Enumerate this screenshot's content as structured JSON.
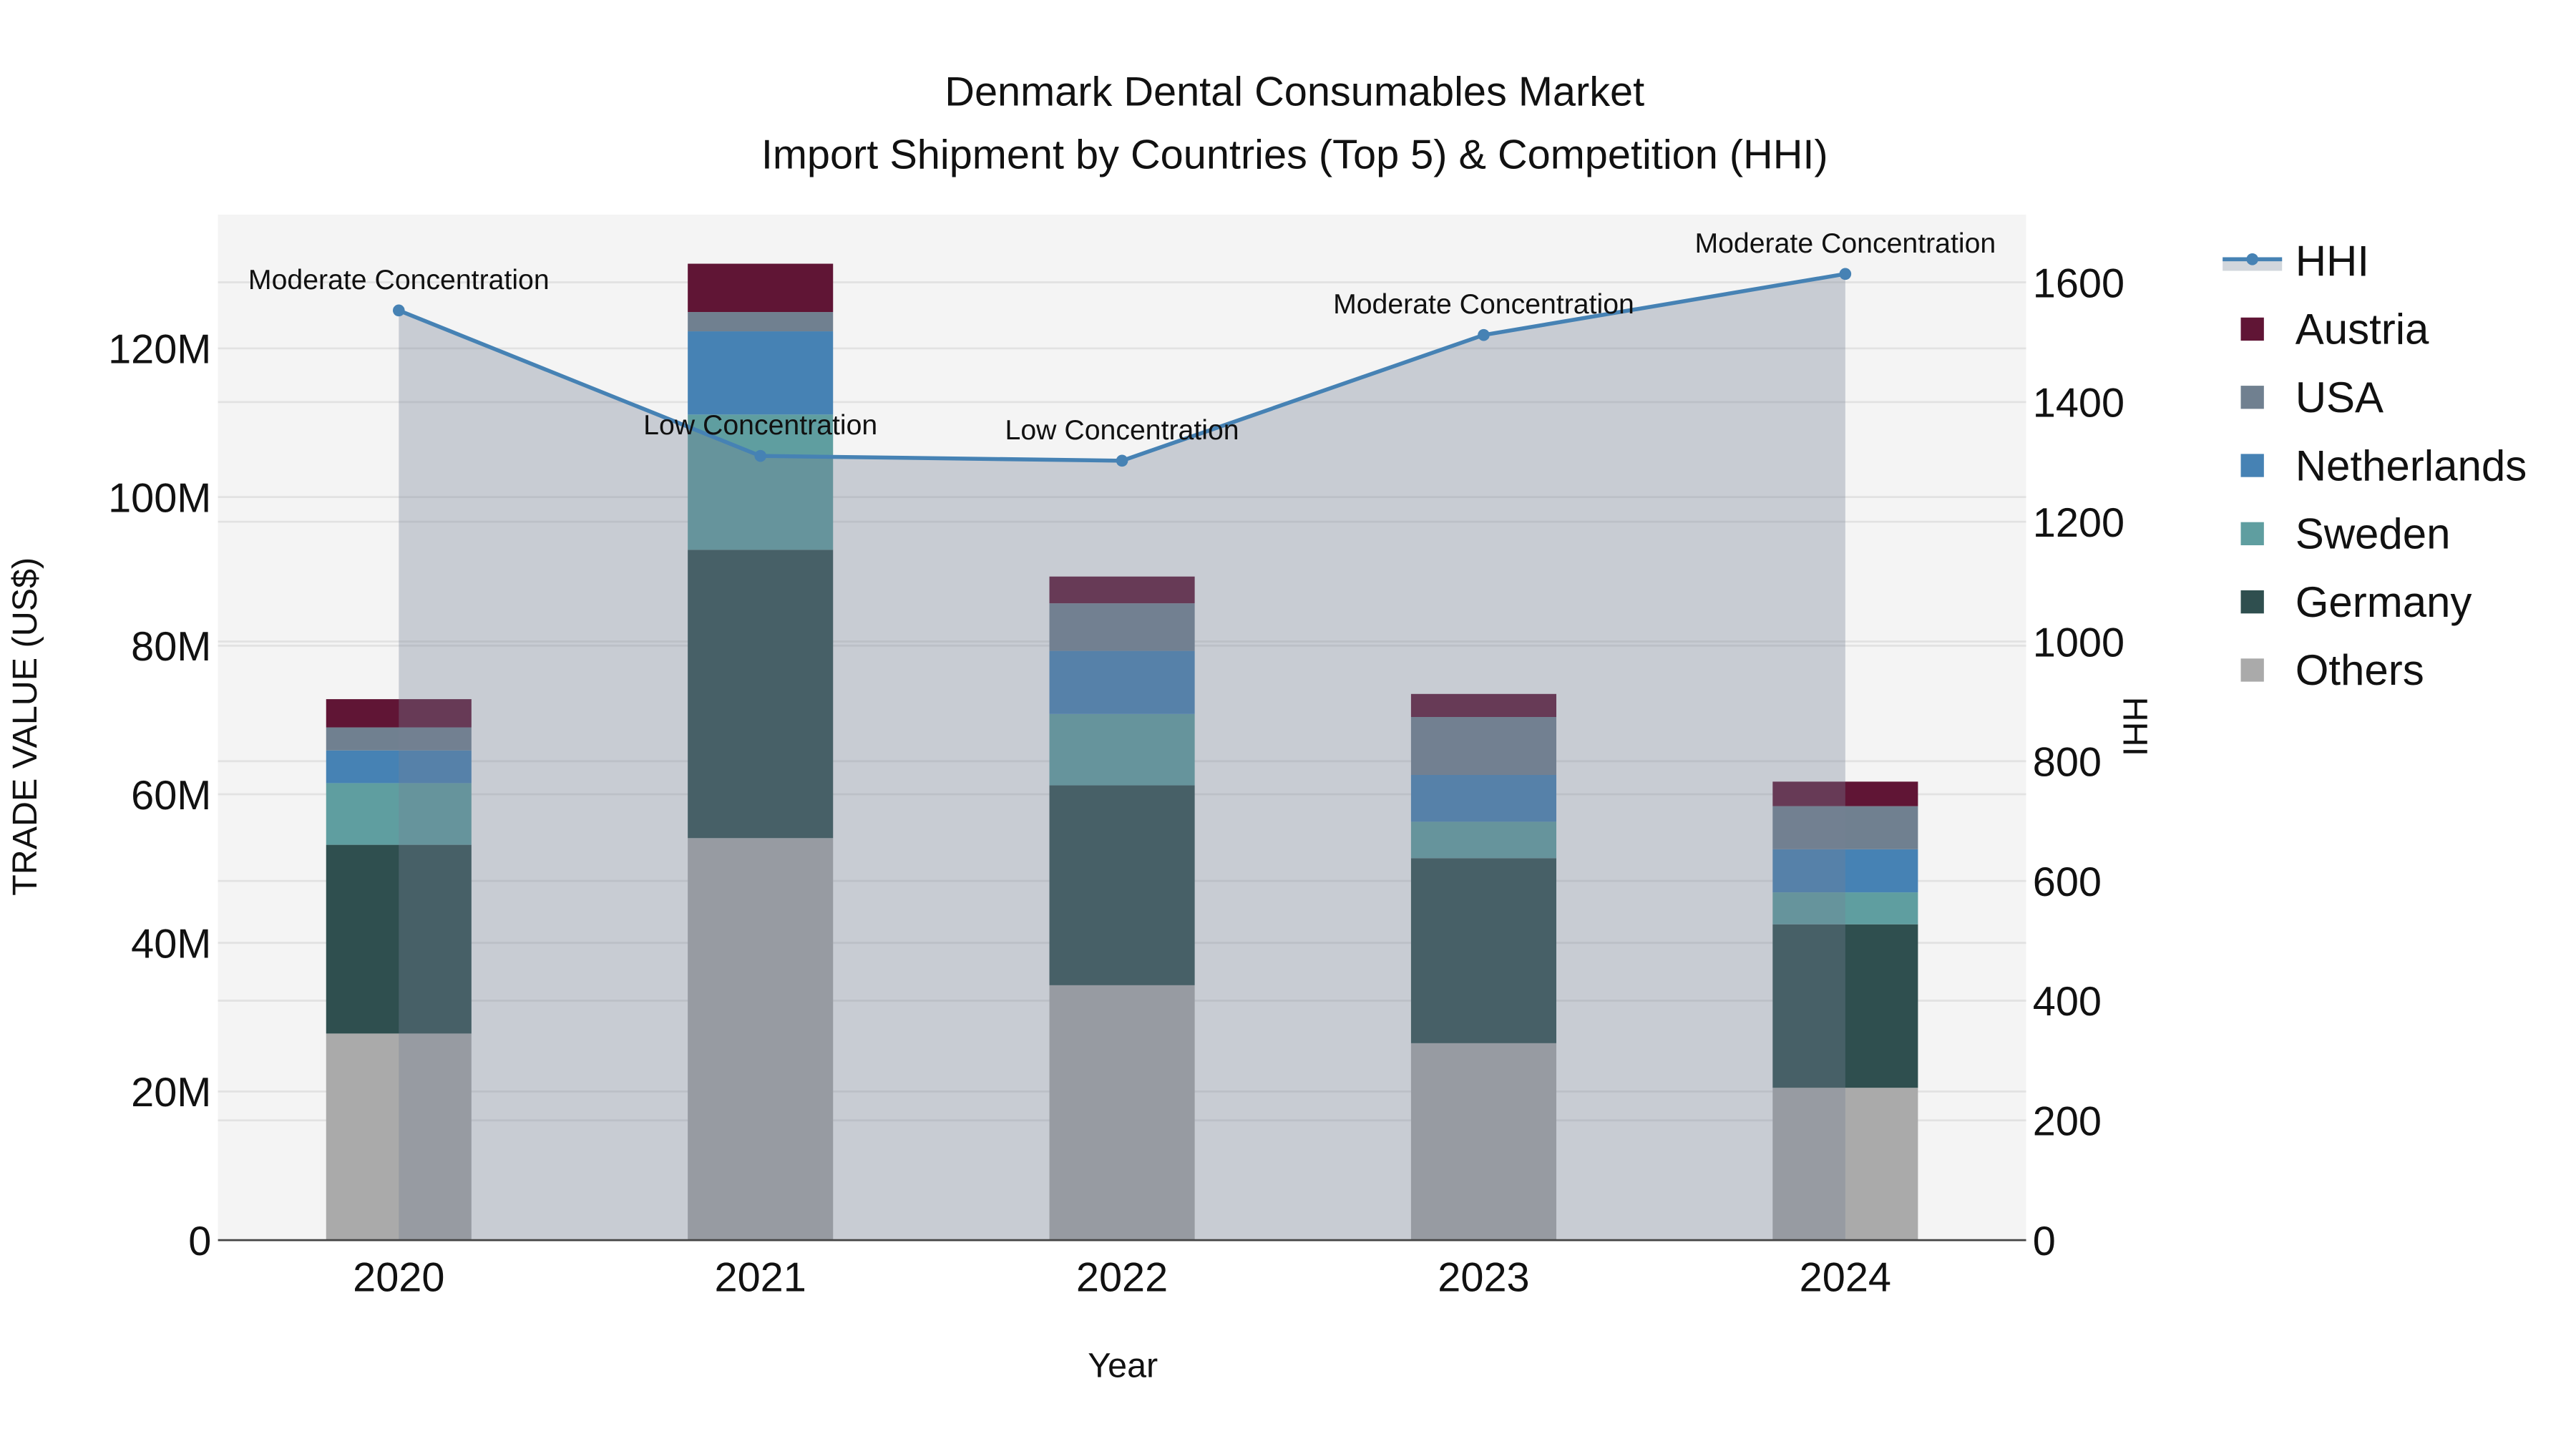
{
  "chart_data": {
    "type": "bar",
    "stacked": true,
    "title": "Denmark Dental Consumables Market",
    "subtitle": "Import Shipment by Countries (Top 5) & Competition (HHI)",
    "xlabel": "Year",
    "ylabel": "TRADE VALUE (US$)",
    "y2label": "HHI",
    "categories": [
      "2020",
      "2021",
      "2022",
      "2023",
      "2024"
    ],
    "ylim": [
      0,
      138000000
    ],
    "yticks": [
      0,
      20000000,
      40000000,
      60000000,
      80000000,
      100000000,
      120000000
    ],
    "ytick_labels": [
      "0",
      "20M",
      "40M",
      "60M",
      "80M",
      "100M",
      "120M"
    ],
    "y2lim": [
      0,
      1713
    ],
    "y2ticks": [
      0,
      200,
      400,
      600,
      800,
      1000,
      1200,
      1400,
      1600
    ],
    "y2tick_labels": [
      "0",
      "200",
      "400",
      "600",
      "800",
      "1000",
      "1200",
      "1400",
      "1600"
    ],
    "grid": true,
    "legend_position": "right",
    "series": [
      {
        "name": "Others",
        "color": "#aaaaaa",
        "values": [
          27.8,
          54.1,
          34.3,
          26.5,
          20.5
        ]
      },
      {
        "name": "Germany",
        "color": "#2f4f4f",
        "values": [
          25.4,
          38.8,
          26.9,
          24.9,
          22.0
        ]
      },
      {
        "name": "Sweden",
        "color": "#5f9ea0",
        "values": [
          8.3,
          18.2,
          9.6,
          4.9,
          4.3
        ]
      },
      {
        "name": "Netherlands",
        "color": "#4682b4",
        "values": [
          4.4,
          11.2,
          8.5,
          6.3,
          5.8
        ]
      },
      {
        "name": "USA",
        "color": "#708090",
        "values": [
          3.1,
          2.6,
          6.4,
          7.8,
          5.8
        ]
      },
      {
        "name": "Austria",
        "color": "#601535",
        "values": [
          3.8,
          6.5,
          3.6,
          3.1,
          3.3
        ]
      }
    ],
    "value_unit": "US$ millions",
    "hhi": {
      "name": "HHI",
      "color": "#4682b4",
      "values": [
        1553,
        1310,
        1302,
        1512,
        1614
      ],
      "annotations": [
        "Moderate Concentration",
        "Low Concentration",
        "Low Concentration",
        "Moderate Concentration",
        "Moderate Concentration"
      ]
    },
    "legend": [
      "HHI",
      "Austria",
      "USA",
      "Netherlands",
      "Sweden",
      "Germany",
      "Others"
    ]
  }
}
